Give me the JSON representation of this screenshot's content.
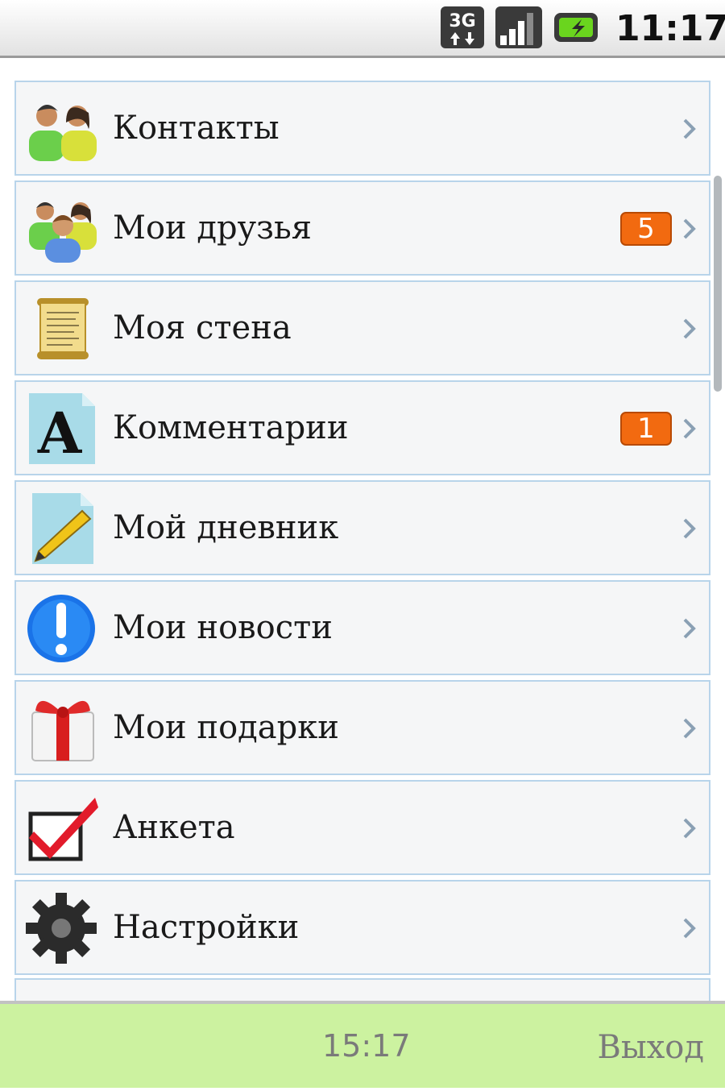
{
  "status_bar": {
    "network": "3G",
    "time": "11:17",
    "icons": [
      "3g-data-icon",
      "signal-strength-icon",
      "battery-charging-icon"
    ]
  },
  "menu": {
    "items": [
      {
        "label": "Контакты",
        "icon": "contacts-icon",
        "badge": null
      },
      {
        "label": "Мои друзья",
        "icon": "friends-icon",
        "badge": "5"
      },
      {
        "label": "Моя стена",
        "icon": "scroll-wall-icon",
        "badge": null
      },
      {
        "label": "Комментарии",
        "icon": "comments-letter-icon",
        "badge": "1"
      },
      {
        "label": "Мой дневник",
        "icon": "diary-pencil-icon",
        "badge": null
      },
      {
        "label": "Мои новости",
        "icon": "news-exclamation-icon",
        "badge": null
      },
      {
        "label": "Мои подарки",
        "icon": "gift-icon",
        "badge": null
      },
      {
        "label": "Анкета",
        "icon": "profile-checkbox-icon",
        "badge": null
      },
      {
        "label": "Настройки",
        "icon": "settings-gear-icon",
        "badge": null
      }
    ]
  },
  "bottom_bar": {
    "time": "15:17",
    "exit_label": "Выход"
  },
  "colors": {
    "badge": "#f26a10",
    "row_border": "#b8d4ea",
    "bottom_bar": "#ccf2a0"
  }
}
